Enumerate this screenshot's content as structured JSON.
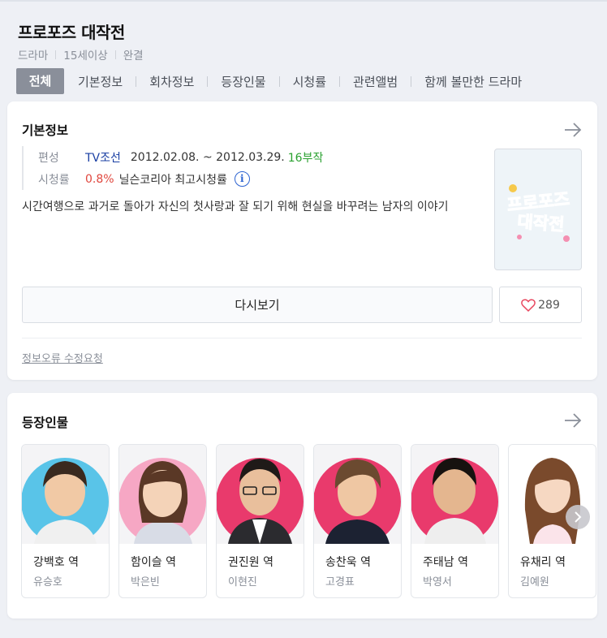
{
  "header": {
    "title": "프로포즈 대작전",
    "meta": [
      "드라마",
      "15세이상",
      "완결"
    ],
    "tabs": [
      "전체",
      "기본정보",
      "회차정보",
      "등장인물",
      "시청률",
      "관련앨범",
      "함께 볼만한 드라마"
    ]
  },
  "info": {
    "section_title": "기본정보",
    "broadcast_label": "편성",
    "network": "TV조선",
    "period": "2012.02.08. ~ 2012.03.29.",
    "episodes": "16부작",
    "rating_label": "시청률",
    "rating_value": "0.8%",
    "rating_source": "닐슨코리아 최고시청률",
    "description": "시간여행으로 과거로 돌아가 자신의 첫사랑과 잘 되기 위해 현실을 바꾸려는 남자의 이야기",
    "poster_text_line1": "프로포즈",
    "poster_text_line2": "대작전",
    "replay_label": "다시보기",
    "like_count": "289",
    "report_label": "정보오류 수정요청"
  },
  "cast": {
    "section_title": "등장인물",
    "members": [
      {
        "role": "강백호 역",
        "actor": "유승호",
        "bg": "#59c4e8"
      },
      {
        "role": "함이슬 역",
        "actor": "박은빈",
        "bg": "#f6a7c4"
      },
      {
        "role": "권진원 역",
        "actor": "이현진",
        "bg": "#e93a6c"
      },
      {
        "role": "송찬욱 역",
        "actor": "고경표",
        "bg": "#e93a6c"
      },
      {
        "role": "주태남 역",
        "actor": "박영서",
        "bg": "#e93a6c"
      },
      {
        "role": "유채리 역",
        "actor": "김예원",
        "bg": "#ffffff"
      }
    ]
  },
  "colors": {
    "accent_blue": "#1a3fa3",
    "rating_red": "#e0463d",
    "episodes_green": "#2aa130",
    "tab_active_bg": "#8a8f9a"
  }
}
